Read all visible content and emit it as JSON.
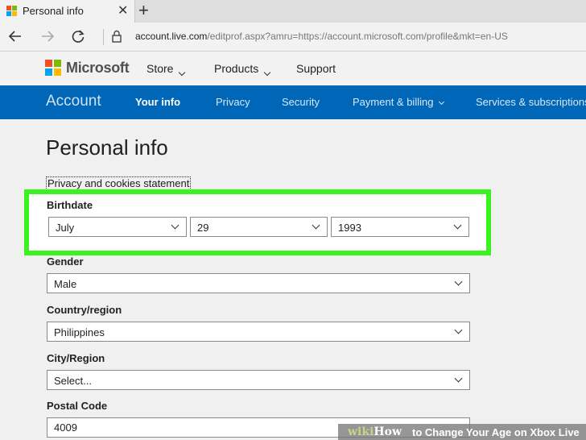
{
  "browser": {
    "tab_title": "Personal info",
    "tab_close": "✕",
    "new_tab": "+",
    "url_domain": "account.live.com",
    "url_rest": "/editprof.aspx?amru=https://account.microsoft.com/profile&mkt=en-US"
  },
  "header": {
    "brand": "Microsoft",
    "nav": [
      {
        "label": "Store"
      },
      {
        "label": "Products"
      },
      {
        "label": "Support"
      }
    ]
  },
  "account_bar": {
    "title": "Account",
    "items": [
      {
        "label": "Your info",
        "active": true
      },
      {
        "label": "Privacy"
      },
      {
        "label": "Security"
      },
      {
        "label": "Payment & billing"
      },
      {
        "label": "Services & subscriptions"
      }
    ]
  },
  "page": {
    "title": "Personal info",
    "privacy_link": "Privacy and cookies statement"
  },
  "form": {
    "birthdate": {
      "label": "Birthdate",
      "month": "July",
      "day": "29",
      "year": "1993"
    },
    "gender": {
      "label": "Gender",
      "value": "Male"
    },
    "country": {
      "label": "Country/region",
      "value": "Philippines"
    },
    "city": {
      "label": "City/Region",
      "value": "Select..."
    },
    "postal": {
      "label": "Postal Code",
      "value": "4009"
    }
  },
  "watermark": {
    "brand_a": "wiki",
    "brand_b": "How",
    "title": "to Change Your Age on Xbox Live"
  },
  "colors": {
    "account_bar": "#0067b8",
    "highlight": "#3af21f",
    "ms_red": "#f25022",
    "ms_green": "#7fba00",
    "ms_blue": "#00a4ef",
    "ms_yellow": "#ffb900"
  }
}
